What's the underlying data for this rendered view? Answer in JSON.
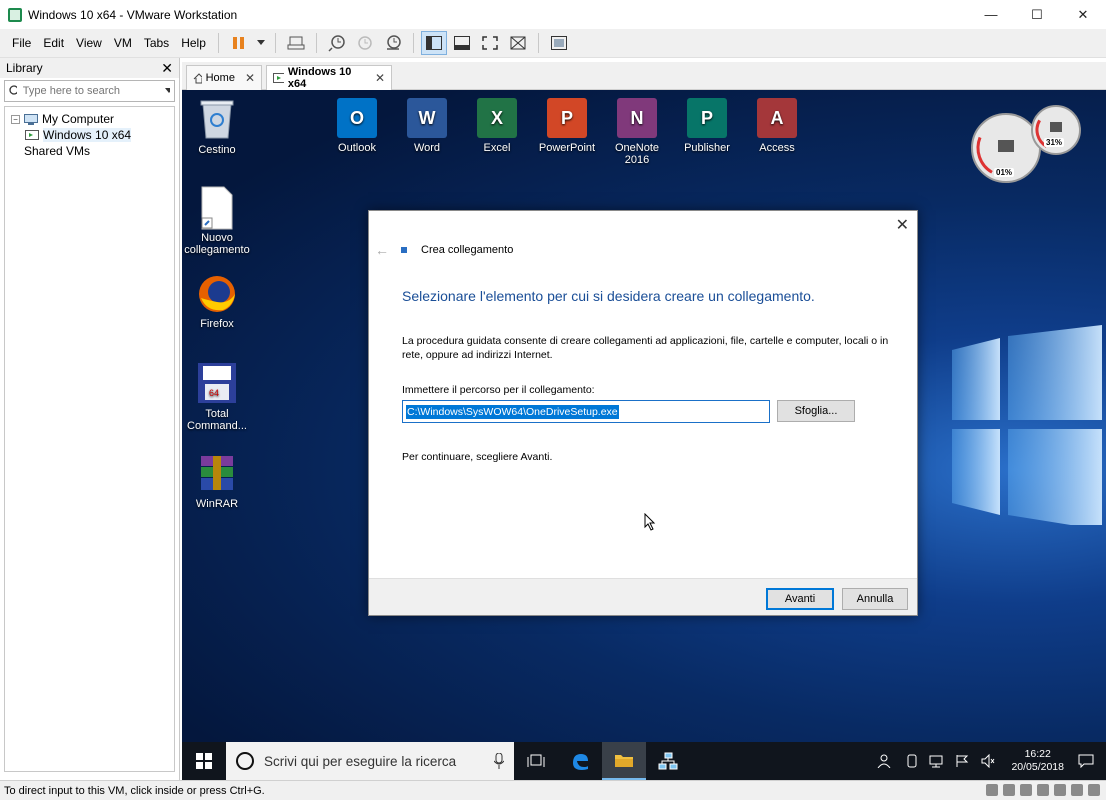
{
  "window": {
    "title": "Windows 10 x64 - VMware Workstation"
  },
  "menu": {
    "items": [
      {
        "label": "File"
      },
      {
        "label": "Edit"
      },
      {
        "label": "View"
      },
      {
        "label": "VM"
      },
      {
        "label": "Tabs"
      },
      {
        "label": "Help"
      }
    ]
  },
  "library": {
    "title": "Library",
    "search_placeholder": "Type here to search",
    "tree": [
      {
        "label": "My Computer"
      },
      {
        "label": "Windows 10 x64"
      },
      {
        "label": "Shared VMs"
      }
    ]
  },
  "tabs": [
    {
      "label": "Home"
    },
    {
      "label": "Windows 10 x64"
    }
  ],
  "desktop": {
    "left_icons": [
      {
        "label": "Cestino"
      },
      {
        "label": "Nuovo collegamento"
      },
      {
        "label": "Firefox"
      },
      {
        "label": "Total Command..."
      },
      {
        "label": "WinRAR"
      }
    ],
    "top_icons": [
      {
        "label": "Outlook",
        "letter": "O",
        "color": "#0072c6"
      },
      {
        "label": "Word",
        "letter": "W",
        "color": "#2b579a"
      },
      {
        "label": "Excel",
        "letter": "X",
        "color": "#217346"
      },
      {
        "label": "PowerPoint",
        "letter": "P",
        "color": "#d24726"
      },
      {
        "label": "OneNote 2016",
        "letter": "N",
        "color": "#80397b"
      },
      {
        "label": "Publisher",
        "letter": "P",
        "color": "#077568"
      },
      {
        "label": "Access",
        "letter": "A",
        "color": "#a4373a"
      }
    ],
    "gadget": {
      "cpu": "01%",
      "mem": "31%"
    }
  },
  "dialog": {
    "title": "Crea collegamento",
    "heading": "Selezionare l'elemento per cui si desidera creare un collegamento.",
    "description": "La procedura guidata consente di creare collegamenti ad applicazioni, file, cartelle e computer, locali o in rete, oppure ad indirizzi Internet.",
    "path_label": "Immettere il percorso per il collegamento:",
    "path_value": "C:\\Windows\\SysWOW64\\OneDriveSetup.exe",
    "browse_label": "Sfoglia...",
    "hint": "Per continuare, scegliere Avanti.",
    "next_label": "Avanti",
    "cancel_label": "Annulla"
  },
  "taskbar": {
    "search_placeholder": "Scrivi qui per eseguire la ricerca",
    "time": "16:22",
    "date": "20/05/2018"
  },
  "status": {
    "text": "To direct input to this VM, click inside or press Ctrl+G."
  }
}
